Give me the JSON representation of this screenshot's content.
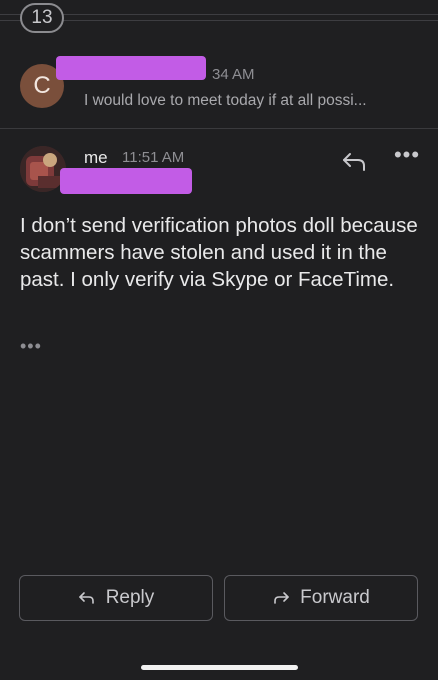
{
  "thread": {
    "message_count": "13"
  },
  "collapsed_message": {
    "avatar_initial": "C",
    "time": "34 AM",
    "snippet": "I would love to meet today if at all possi..."
  },
  "open_message": {
    "sender": "me",
    "time": "11:51 AM",
    "body": "I don’t send verification photos doll because scammers have stolen and used it in the past. I only verify via Skype or FaceTime.",
    "trimmed_content": "•••",
    "more_label": "•••"
  },
  "actions": {
    "reply_label": "Reply",
    "forward_label": "Forward"
  },
  "colors": {
    "background": "#1f1f21",
    "redaction": "#c25ce6",
    "avatar_c": "#7a4f3b"
  }
}
